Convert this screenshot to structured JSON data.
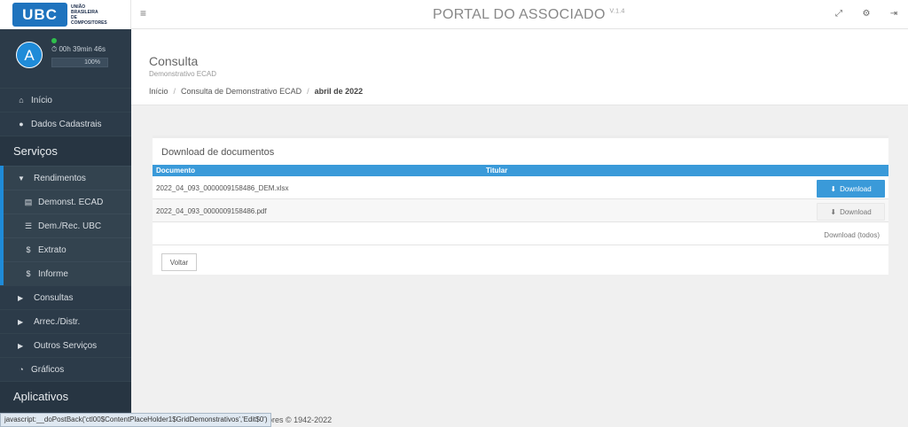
{
  "logo": {
    "mark": "UBC",
    "lines": [
      "UNIÃO",
      "BRASILEIRA",
      "DE",
      "COMPOSITORES"
    ]
  },
  "header": {
    "title": "PORTAL DO ASSOCIADO",
    "version": "V.1.4",
    "icons": [
      "expand-icon",
      "settings-icon",
      "logout-icon"
    ]
  },
  "user": {
    "avatar_letter": "A",
    "session_timer": "⏱ 00h 39min 46s",
    "progress": "100%"
  },
  "sidebar": {
    "inicio": "Início",
    "dados": "Dados Cadastrais",
    "servicos_header": "Serviços",
    "rendimentos": "Rendimentos",
    "sub": [
      "Demonst. ECAD",
      "Dem./Rec. UBC",
      "Extrato",
      "Informe"
    ],
    "consultas": "Consultas",
    "arrec": "Arrec./Distr.",
    "outros": "Outros Serviços",
    "graficos": "Gráficos",
    "aplicativos_header": "Aplicativos"
  },
  "page": {
    "title": "Consulta",
    "subtitle": "Demonstrativo ECAD",
    "breadcrumb": [
      "Início",
      "Consulta de Demonstrativo ECAD",
      "abril de 2022"
    ]
  },
  "panel": {
    "title": "Download de documentos",
    "columns": [
      "Documento",
      "Titular"
    ],
    "rows": [
      {
        "file": "2022_04_093_0000009158486_DEM.xlsx",
        "button": "Download"
      },
      {
        "file": "2022_04_093_0000009158486.pdf",
        "button": "Download"
      }
    ],
    "download_all": "Download (todos)",
    "back": "Voltar"
  },
  "footer": {
    "text": "ositores © 1942-2022"
  },
  "status_url": "javascript:__doPostBack('ctl00$ContentPlaceHolder1$GridDemonstrativos','Edit$0')",
  "colors": {
    "sidebar": "#2c3b49",
    "accent": "#3a9ad9"
  }
}
